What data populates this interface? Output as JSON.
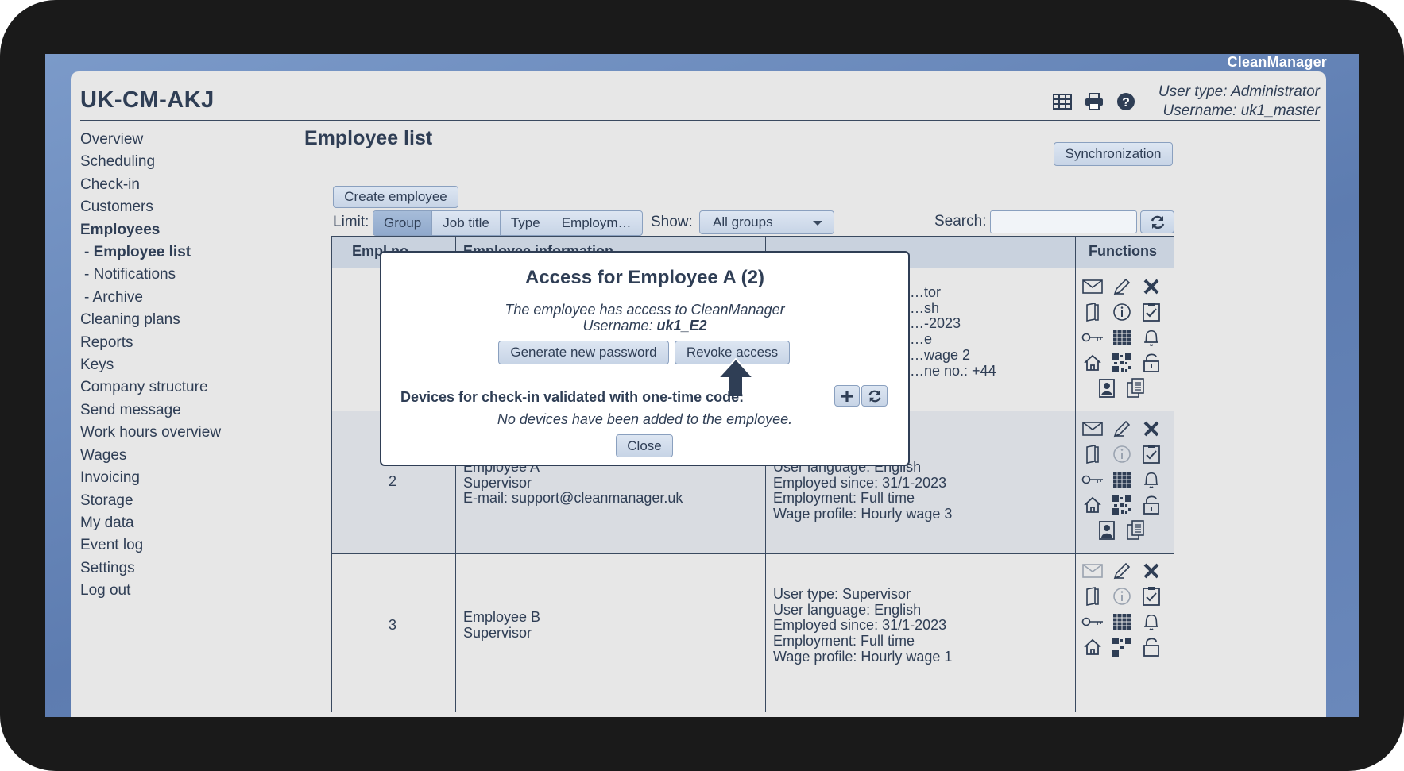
{
  "brand": "CleanManager",
  "app": {
    "title": "UK-CM-AKJ",
    "user_type": "User type: Administrator",
    "username": "Username: uk1_master",
    "header_icons": [
      "table-icon",
      "print-icon",
      "help-icon"
    ]
  },
  "sidebar": {
    "items": [
      {
        "label": "Overview"
      },
      {
        "label": "Scheduling"
      },
      {
        "label": "Check-in"
      },
      {
        "label": "Customers"
      },
      {
        "label": "Employees"
      },
      {
        "label": "- Employee list"
      },
      {
        "label": "- Notifications"
      },
      {
        "label": "- Archive"
      },
      {
        "label": "Cleaning plans"
      },
      {
        "label": "Reports"
      },
      {
        "label": "Keys"
      },
      {
        "label": "Company structure"
      },
      {
        "label": "Send message"
      },
      {
        "label": "Work hours overview"
      },
      {
        "label": "Wages"
      },
      {
        "label": "Invoicing"
      },
      {
        "label": "Storage"
      },
      {
        "label": "My data"
      },
      {
        "label": "Event log"
      },
      {
        "label": "Settings"
      },
      {
        "label": "Log out"
      }
    ]
  },
  "main": {
    "title": "Employee list",
    "sync_label": "Synchronization",
    "create_label": "Create employee",
    "limit_label": "Limit:",
    "limit_tabs": [
      "Group",
      "Job title",
      "Type",
      "Employm…"
    ],
    "show_label": "Show:",
    "show_value": "All groups",
    "search_label": "Search:",
    "search_value": ""
  },
  "table": {
    "headers": {
      "empl_no": "Empl.no.",
      "info": "Employee information",
      "functions": "Functions"
    },
    "rows": [
      {
        "no": "",
        "info": [],
        "details": [
          "…tor",
          "…sh",
          "…-2023",
          "…e",
          "…wage 2",
          "…ne no.: +44"
        ]
      },
      {
        "no": "2",
        "info": [
          "Employee A",
          "Supervisor",
          "E-mail: support@cleanmanager.uk"
        ],
        "details": [
          "User language: English",
          "Employed since: 31/1-2023",
          "Employment: Full time",
          "Wage profile: Hourly wage 3"
        ]
      },
      {
        "no": "3",
        "info": [
          "Employee B",
          "Supervisor"
        ],
        "details": [
          "User type: Supervisor",
          "User language: English",
          "Employed since: 31/1-2023",
          "Employment: Full time",
          "Wage profile: Hourly wage 1"
        ]
      }
    ]
  },
  "modal": {
    "title": "Access for Employee A (2)",
    "access_text": "The employee has access to CleanManager",
    "username_label": "Username: ",
    "username_value": "uk1_E2",
    "generate_label": "Generate new password",
    "revoke_label": "Revoke access",
    "devices_heading": "Devices for check-in validated with one-time code:",
    "no_devices_text": "No devices have been added to the employee.",
    "close_label": "Close"
  },
  "colors": {
    "accent": "#2f3e55",
    "button_bg": "#c7d4e6",
    "frame": "#1a1a1a",
    "desktop": "#6a88bb"
  }
}
